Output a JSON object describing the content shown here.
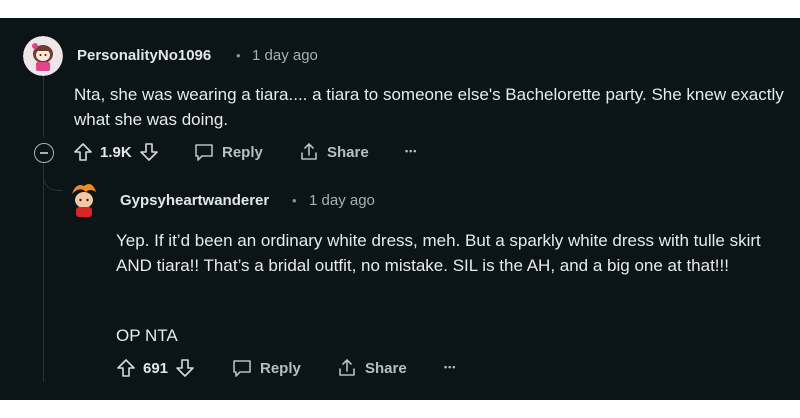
{
  "comment": {
    "username": "PersonalityNo1096",
    "separator": "•",
    "time": "1 day ago",
    "text": "Nta, she was wearing a tiara.... a tiara to someone else's Bachelorette party. She knew exactly what she was doing.",
    "votes": "1.9K",
    "reply_label": "Reply",
    "share_label": "Share",
    "more_label": "•••"
  },
  "reply": {
    "username": "Gypsyheartwanderer",
    "separator": "•",
    "time": "1 day ago",
    "text_paragraph_1": "Yep. If it’d been an ordinary white dress, meh. But a sparkly white dress with tulle skirt AND tiara!! That’s a bridal outfit, no mistake. SIL is the AH, and a big one at that!!!",
    "text_paragraph_2": "OP NTA",
    "votes": "691",
    "reply_label": "Reply",
    "share_label": "Share",
    "more_label": "•••"
  },
  "colors": {
    "background": "#0b1416",
    "text": "#e8eaeb",
    "muted": "#a9b0b3"
  }
}
